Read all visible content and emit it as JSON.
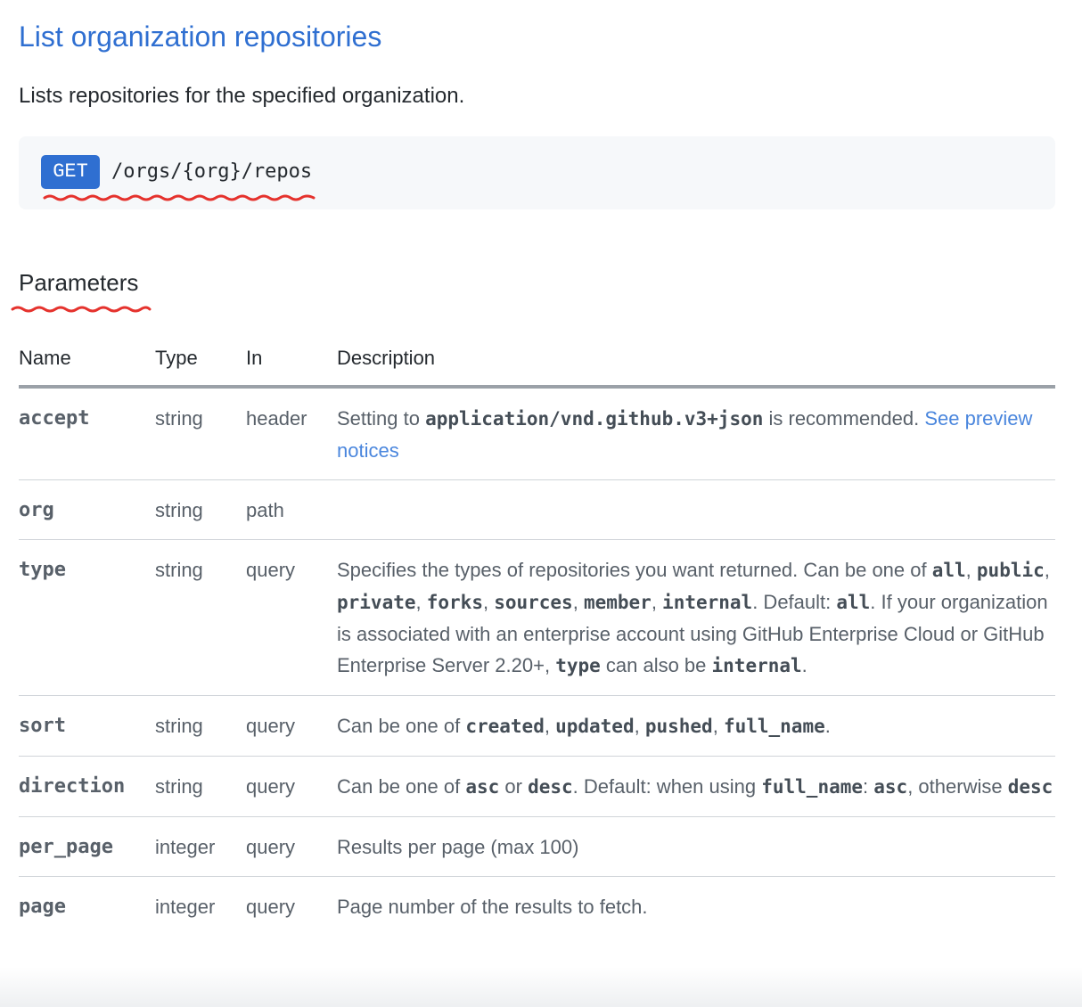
{
  "page": {
    "title": "List organization repositories",
    "summary": "Lists repositories for the specified organization."
  },
  "endpoint": {
    "method": "GET",
    "path": "/orgs/{org}/repos"
  },
  "parameters": {
    "heading": "Parameters",
    "columns": {
      "name": "Name",
      "type": "Type",
      "in": "In",
      "description": "Description"
    },
    "rows": [
      {
        "name": "accept",
        "type": "string",
        "in": "header",
        "desc": [
          {
            "t": "text",
            "v": "Setting to "
          },
          {
            "t": "code",
            "v": "application/vnd.github.v3+json"
          },
          {
            "t": "text",
            "v": " is recommended. "
          },
          {
            "t": "link",
            "v": "See preview notices"
          }
        ]
      },
      {
        "name": "org",
        "type": "string",
        "in": "path",
        "desc": []
      },
      {
        "name": "type",
        "type": "string",
        "in": "query",
        "desc": [
          {
            "t": "text",
            "v": "Specifies the types of repositories you want returned. Can be one of "
          },
          {
            "t": "code",
            "v": "all"
          },
          {
            "t": "text",
            "v": ", "
          },
          {
            "t": "code",
            "v": "public"
          },
          {
            "t": "text",
            "v": ", "
          },
          {
            "t": "code",
            "v": "private"
          },
          {
            "t": "text",
            "v": ", "
          },
          {
            "t": "code",
            "v": "forks"
          },
          {
            "t": "text",
            "v": ", "
          },
          {
            "t": "code",
            "v": "sources"
          },
          {
            "t": "text",
            "v": ", "
          },
          {
            "t": "code",
            "v": "member"
          },
          {
            "t": "text",
            "v": ", "
          },
          {
            "t": "code",
            "v": "internal"
          },
          {
            "t": "text",
            "v": ". Default: "
          },
          {
            "t": "code",
            "v": "all"
          },
          {
            "t": "text",
            "v": ". If your organization is associated with an enterprise account using GitHub Enterprise Cloud or GitHub Enterprise Server 2.20+, "
          },
          {
            "t": "code",
            "v": "type"
          },
          {
            "t": "text",
            "v": " can also be "
          },
          {
            "t": "code",
            "v": "internal"
          },
          {
            "t": "text",
            "v": "."
          }
        ]
      },
      {
        "name": "sort",
        "type": "string",
        "in": "query",
        "desc": [
          {
            "t": "text",
            "v": "Can be one of "
          },
          {
            "t": "code",
            "v": "created"
          },
          {
            "t": "text",
            "v": ", "
          },
          {
            "t": "code",
            "v": "updated"
          },
          {
            "t": "text",
            "v": ", "
          },
          {
            "t": "code",
            "v": "pushed"
          },
          {
            "t": "text",
            "v": ", "
          },
          {
            "t": "code",
            "v": "full_name"
          },
          {
            "t": "text",
            "v": "."
          }
        ]
      },
      {
        "name": "direction",
        "type": "string",
        "in": "query",
        "desc": [
          {
            "t": "text",
            "v": "Can be one of "
          },
          {
            "t": "code",
            "v": "asc"
          },
          {
            "t": "text",
            "v": " or "
          },
          {
            "t": "code",
            "v": "desc"
          },
          {
            "t": "text",
            "v": ". Default: when using "
          },
          {
            "t": "code",
            "v": "full_name"
          },
          {
            "t": "text",
            "v": ": "
          },
          {
            "t": "code",
            "v": "asc"
          },
          {
            "t": "text",
            "v": ", otherwise "
          },
          {
            "t": "code",
            "v": "desc"
          }
        ]
      },
      {
        "name": "per_page",
        "type": "integer",
        "in": "query",
        "desc": [
          {
            "t": "text",
            "v": "Results per page (max 100)"
          }
        ]
      },
      {
        "name": "page",
        "type": "integer",
        "in": "query",
        "desc": [
          {
            "t": "text",
            "v": "Page number of the results to fetch."
          }
        ]
      }
    ]
  },
  "colors": {
    "link": "#2f6fd1",
    "badge_bg": "#2f6fd1",
    "annotation": "#e5322d"
  }
}
